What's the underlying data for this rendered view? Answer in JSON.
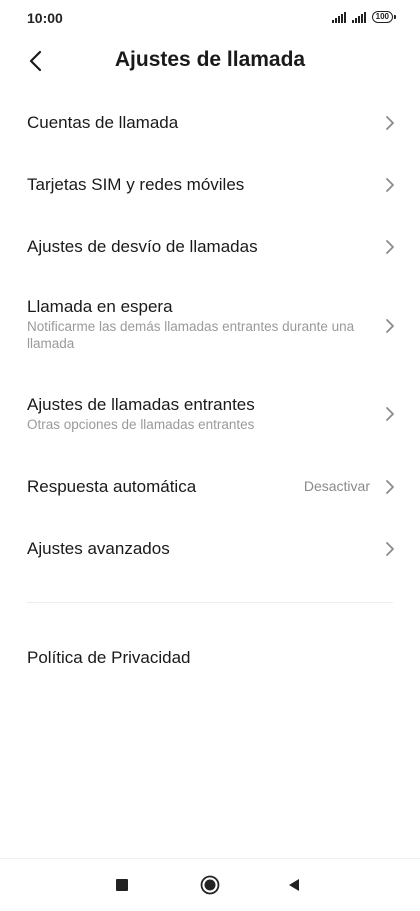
{
  "status_bar": {
    "time": "10:00",
    "battery": "100",
    "icons": [
      "signal-icon",
      "signal-icon",
      "battery-icon"
    ]
  },
  "header": {
    "back_icon": "back-arrow-icon",
    "title": "Ajustes de llamada"
  },
  "items": [
    {
      "title": "Cuentas de llamada",
      "subtitle": "",
      "value": ""
    },
    {
      "title": "Tarjetas SIM y redes móviles",
      "subtitle": "",
      "value": ""
    },
    {
      "title": "Ajustes de desvío de llamadas",
      "subtitle": "",
      "value": ""
    },
    {
      "title": "Llamada en espera",
      "subtitle": "Notificarme las demás llamadas entrantes durante una llamada",
      "value": ""
    },
    {
      "title": "Ajustes de llamadas entrantes",
      "subtitle": "Otras opciones de llamadas entrantes",
      "value": ""
    },
    {
      "title": "Respuesta automática",
      "subtitle": "",
      "value": "Desactivar"
    },
    {
      "title": "Ajustes avanzados",
      "subtitle": "",
      "value": ""
    }
  ],
  "privacy": {
    "title": "Política de Privacidad"
  },
  "nav_bar": {
    "icons": [
      "recents-square-icon",
      "home-circle-icon",
      "back-triangle-icon"
    ]
  },
  "colors": {
    "text": "#1a1a1a",
    "subtext": "#9a9a9a",
    "chevron": "#8a8a8a",
    "background": "#ffffff"
  }
}
